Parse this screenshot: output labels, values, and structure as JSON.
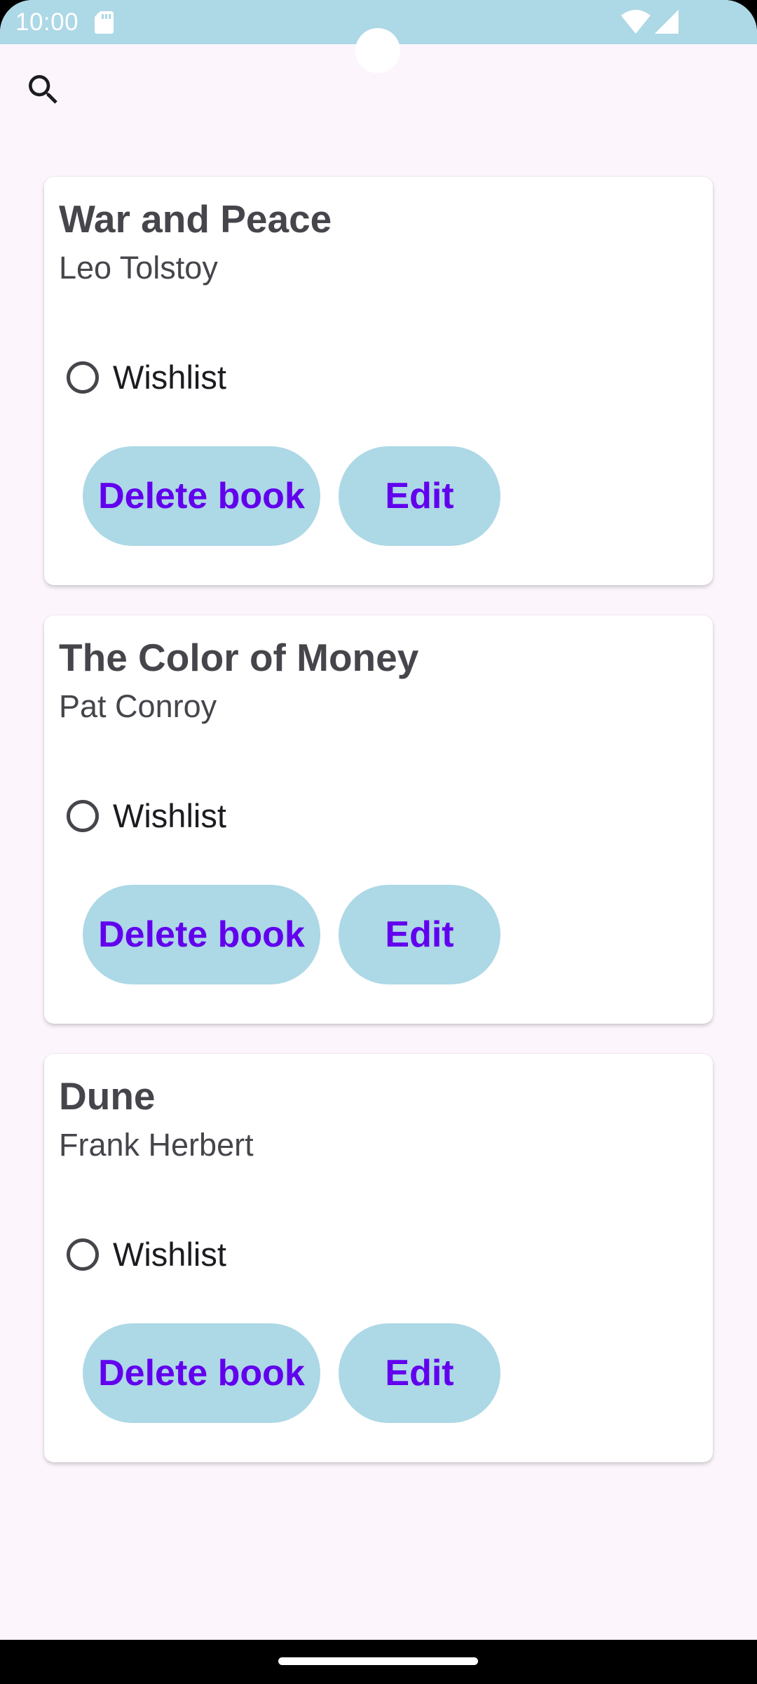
{
  "status_bar": {
    "time": "10:00",
    "icons": [
      "sd-card-icon",
      "wifi-icon",
      "cell-signal-icon"
    ],
    "background_color": "#add8e6"
  },
  "toolbar": {
    "search_icon": "search-icon"
  },
  "books": [
    {
      "title": "War and Peace",
      "author": "Leo Tolstoy",
      "wishlist_label": "Wishlist",
      "wishlist_checked": false,
      "delete_label": "Delete book",
      "edit_label": "Edit"
    },
    {
      "title": "The Color of Money",
      "author": "Pat Conroy",
      "wishlist_label": "Wishlist",
      "wishlist_checked": false,
      "delete_label": "Delete book",
      "edit_label": "Edit"
    },
    {
      "title": "Dune",
      "author": "Frank Herbert",
      "wishlist_label": "Wishlist",
      "wishlist_checked": false,
      "delete_label": "Delete book",
      "edit_label": "Edit"
    }
  ],
  "colors": {
    "button_background": "#add8e6",
    "button_text": "#6200ee",
    "page_background": "#fcf6fc",
    "title_text": "#46454b"
  }
}
